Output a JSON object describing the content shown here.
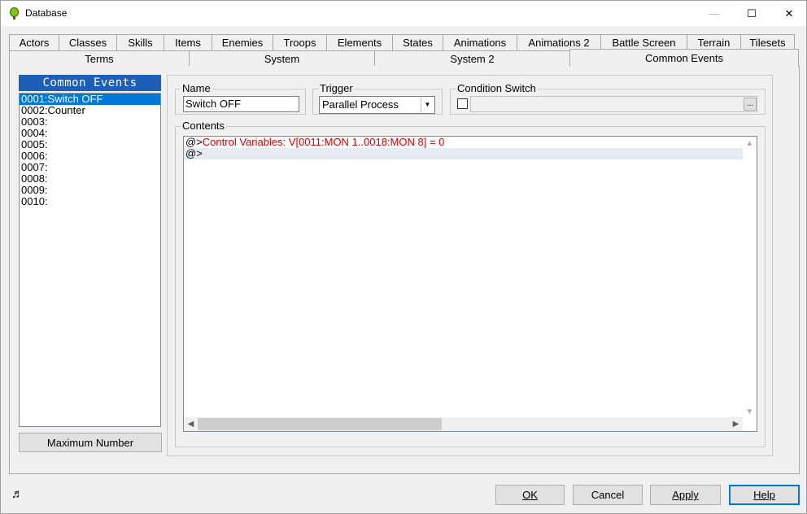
{
  "window": {
    "title": "Database",
    "minimize_glyph": "—",
    "maximize_glyph": "☐",
    "close_glyph": "✕"
  },
  "tabs_row1": [
    "Actors",
    "Classes",
    "Skills",
    "Items",
    "Enemies",
    "Troops",
    "Elements",
    "States",
    "Animations",
    "Animations 2",
    "Battle Screen",
    "Terrain",
    "Tilesets"
  ],
  "tabs_row2": [
    "Terms",
    "System",
    "System 2",
    "Common Events"
  ],
  "active_tab": "Common Events",
  "sidebar": {
    "header": "Common Events",
    "items": [
      "0001:Switch OFF",
      "0002:Counter",
      "0003:",
      "0004:",
      "0005:",
      "0006:",
      "0007:",
      "0008:",
      "0009:",
      "0010:"
    ],
    "selected_index": 0,
    "max_button": "Maximum Number"
  },
  "editor": {
    "name_label": "Name",
    "name_value": "Switch OFF",
    "trigger_label": "Trigger",
    "trigger_value": "Parallel Process",
    "condition_label": "Condition Switch",
    "condition_dots": "...",
    "contents_label": "Contents",
    "lines": [
      {
        "prefix": "@>",
        "command": "Control Variables: V[0011:MON 1..0018:MON 8] = 0"
      },
      {
        "prefix": "@>",
        "command": ""
      }
    ]
  },
  "footer": {
    "ok": "OK",
    "cancel": "Cancel",
    "apply": "Apply",
    "help": "Help",
    "music_icon": "music-note-icon"
  },
  "colors": {
    "header_blue": "#1c5eb8",
    "selection": "#0078d7",
    "command_red": "#d40000"
  }
}
